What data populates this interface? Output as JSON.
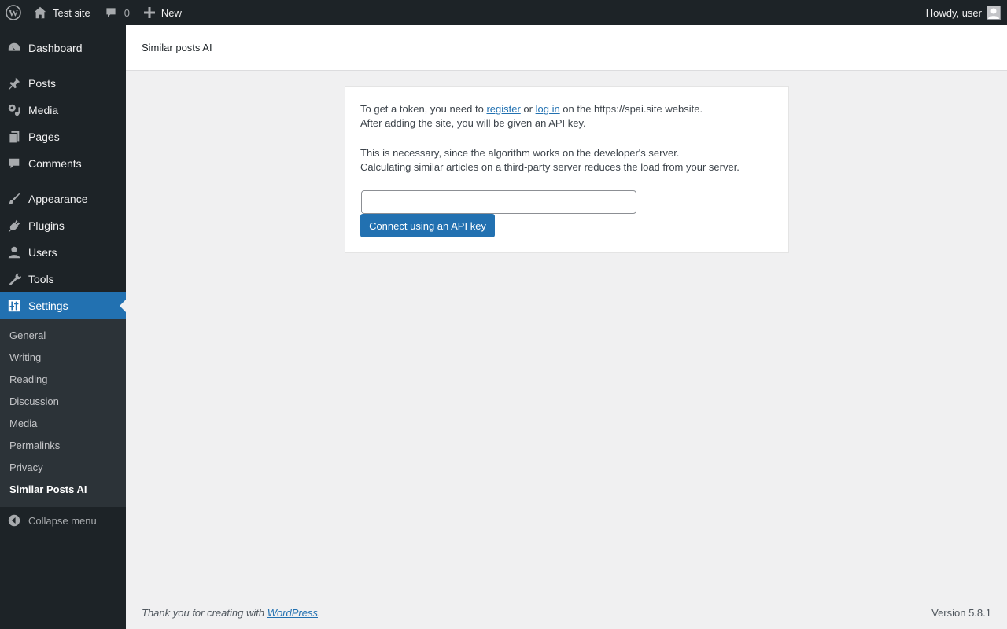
{
  "adminbar": {
    "site_name": "Test site",
    "comments_count": "0",
    "new_label": "New",
    "howdy": "Howdy, user"
  },
  "sidebar": {
    "items": [
      {
        "label": "Dashboard",
        "icon": "dashboard-icon"
      },
      {
        "label": "Posts",
        "icon": "pushpin-icon"
      },
      {
        "label": "Media",
        "icon": "media-icon"
      },
      {
        "label": "Pages",
        "icon": "pages-icon"
      },
      {
        "label": "Comments",
        "icon": "comment-icon"
      },
      {
        "label": "Appearance",
        "icon": "paintbrush-icon"
      },
      {
        "label": "Plugins",
        "icon": "plug-icon"
      },
      {
        "label": "Users",
        "icon": "user-icon"
      },
      {
        "label": "Tools",
        "icon": "wrench-icon"
      },
      {
        "label": "Settings",
        "icon": "sliders-icon",
        "current": true
      }
    ],
    "submenu": [
      "General",
      "Writing",
      "Reading",
      "Discussion",
      "Media",
      "Permalinks",
      "Privacy",
      "Similar Posts AI"
    ],
    "collapse_label": "Collapse menu"
  },
  "header": {
    "title": "Similar posts AI"
  },
  "card": {
    "line1_pre": "To get a token, you need to ",
    "register_link": "register",
    "line1_or": " or ",
    "login_link": "log in",
    "line1_post": " on the https://spai.site website.",
    "line2": "After adding the site, you will be given an API key.",
    "line3": "This is necessary, since the algorithm works on the developer's server.",
    "line4": "Calculating similar articles on a third-party server reduces the load from your server.",
    "api_key_value": "",
    "connect_button": "Connect using an API key"
  },
  "footer": {
    "thanks_pre": "Thank you for creating with ",
    "wordpress_link": "WordPress",
    "thanks_post": ".",
    "version": "Version 5.8.1"
  },
  "colors": {
    "admin_dark": "#1d2327",
    "submenu_bg": "#2c3338",
    "accent": "#2271b1",
    "page_bg": "#f0f0f1"
  }
}
